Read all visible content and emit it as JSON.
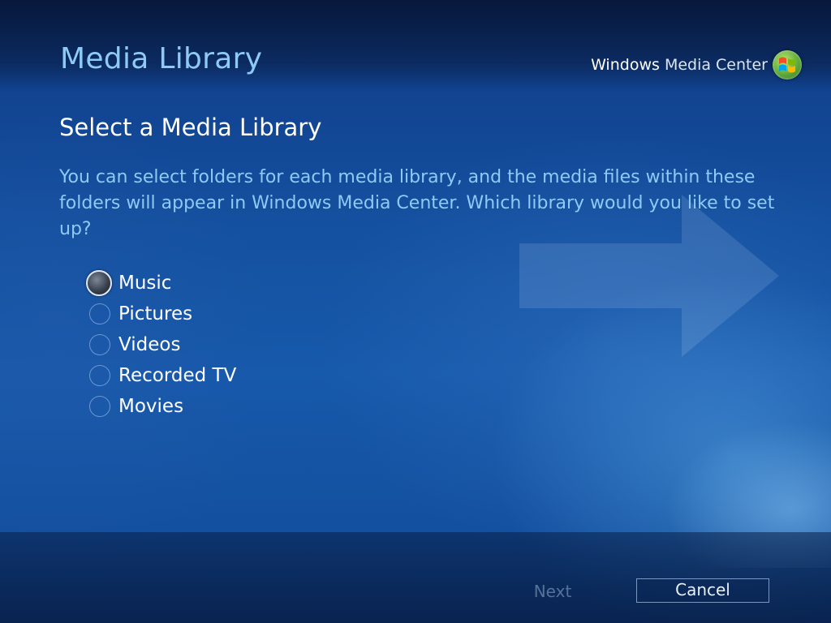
{
  "header": {
    "title": "Media Library",
    "brand_bold": "Windows",
    "brand_light": "Media Center"
  },
  "main": {
    "heading": "Select a Media Library",
    "description": "You can select folders for each media library, and the media files within these folders will appear in Windows Media Center.  Which library would you like to set up?",
    "options": [
      {
        "label": "Music",
        "selected": true
      },
      {
        "label": "Pictures",
        "selected": false
      },
      {
        "label": "Videos",
        "selected": false
      },
      {
        "label": "Recorded TV",
        "selected": false
      },
      {
        "label": "Movies",
        "selected": false
      }
    ]
  },
  "footer": {
    "next_label": "Next",
    "cancel_label": "Cancel"
  },
  "colors": {
    "accent_text": "#8fcaf7",
    "background": "#1759ab"
  },
  "icons": {
    "brand": "windows-logo-icon",
    "background": "arrow-icon"
  }
}
